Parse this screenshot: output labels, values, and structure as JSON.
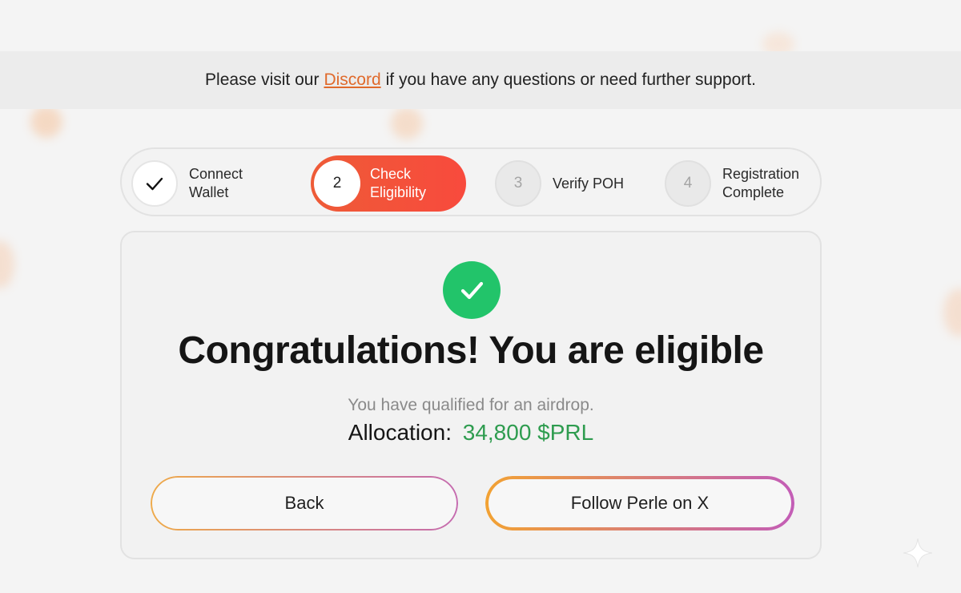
{
  "notice": {
    "before": "Please visit our",
    "link": "Discord",
    "after": "if you have any questions or need further support."
  },
  "steps": [
    {
      "number": "✓",
      "label_line1": "Connect",
      "label_line2": "Wallet",
      "state": "complete"
    },
    {
      "number": "2",
      "label_line1": "Check",
      "label_line2": "Eligibility",
      "state": "active"
    },
    {
      "number": "3",
      "label_line1": "Verify POH",
      "label_line2": "",
      "state": "pending"
    },
    {
      "number": "4",
      "label_line1": "Registration",
      "label_line2": "Complete",
      "state": "pending"
    }
  ],
  "result": {
    "icon": "check-circle-icon",
    "headline": "Congratulations! You are eligible",
    "subtext": "You have qualified for an airdrop.",
    "allocation_label": "Allocation:",
    "allocation_value": "34,800 $PRL"
  },
  "buttons": {
    "back": "Back",
    "follow": "Follow Perle on X"
  },
  "colors": {
    "accent": "#f84a3d",
    "success": "#22c46a",
    "allocation": "#2e9c4f",
    "link": "#e06a2c"
  }
}
